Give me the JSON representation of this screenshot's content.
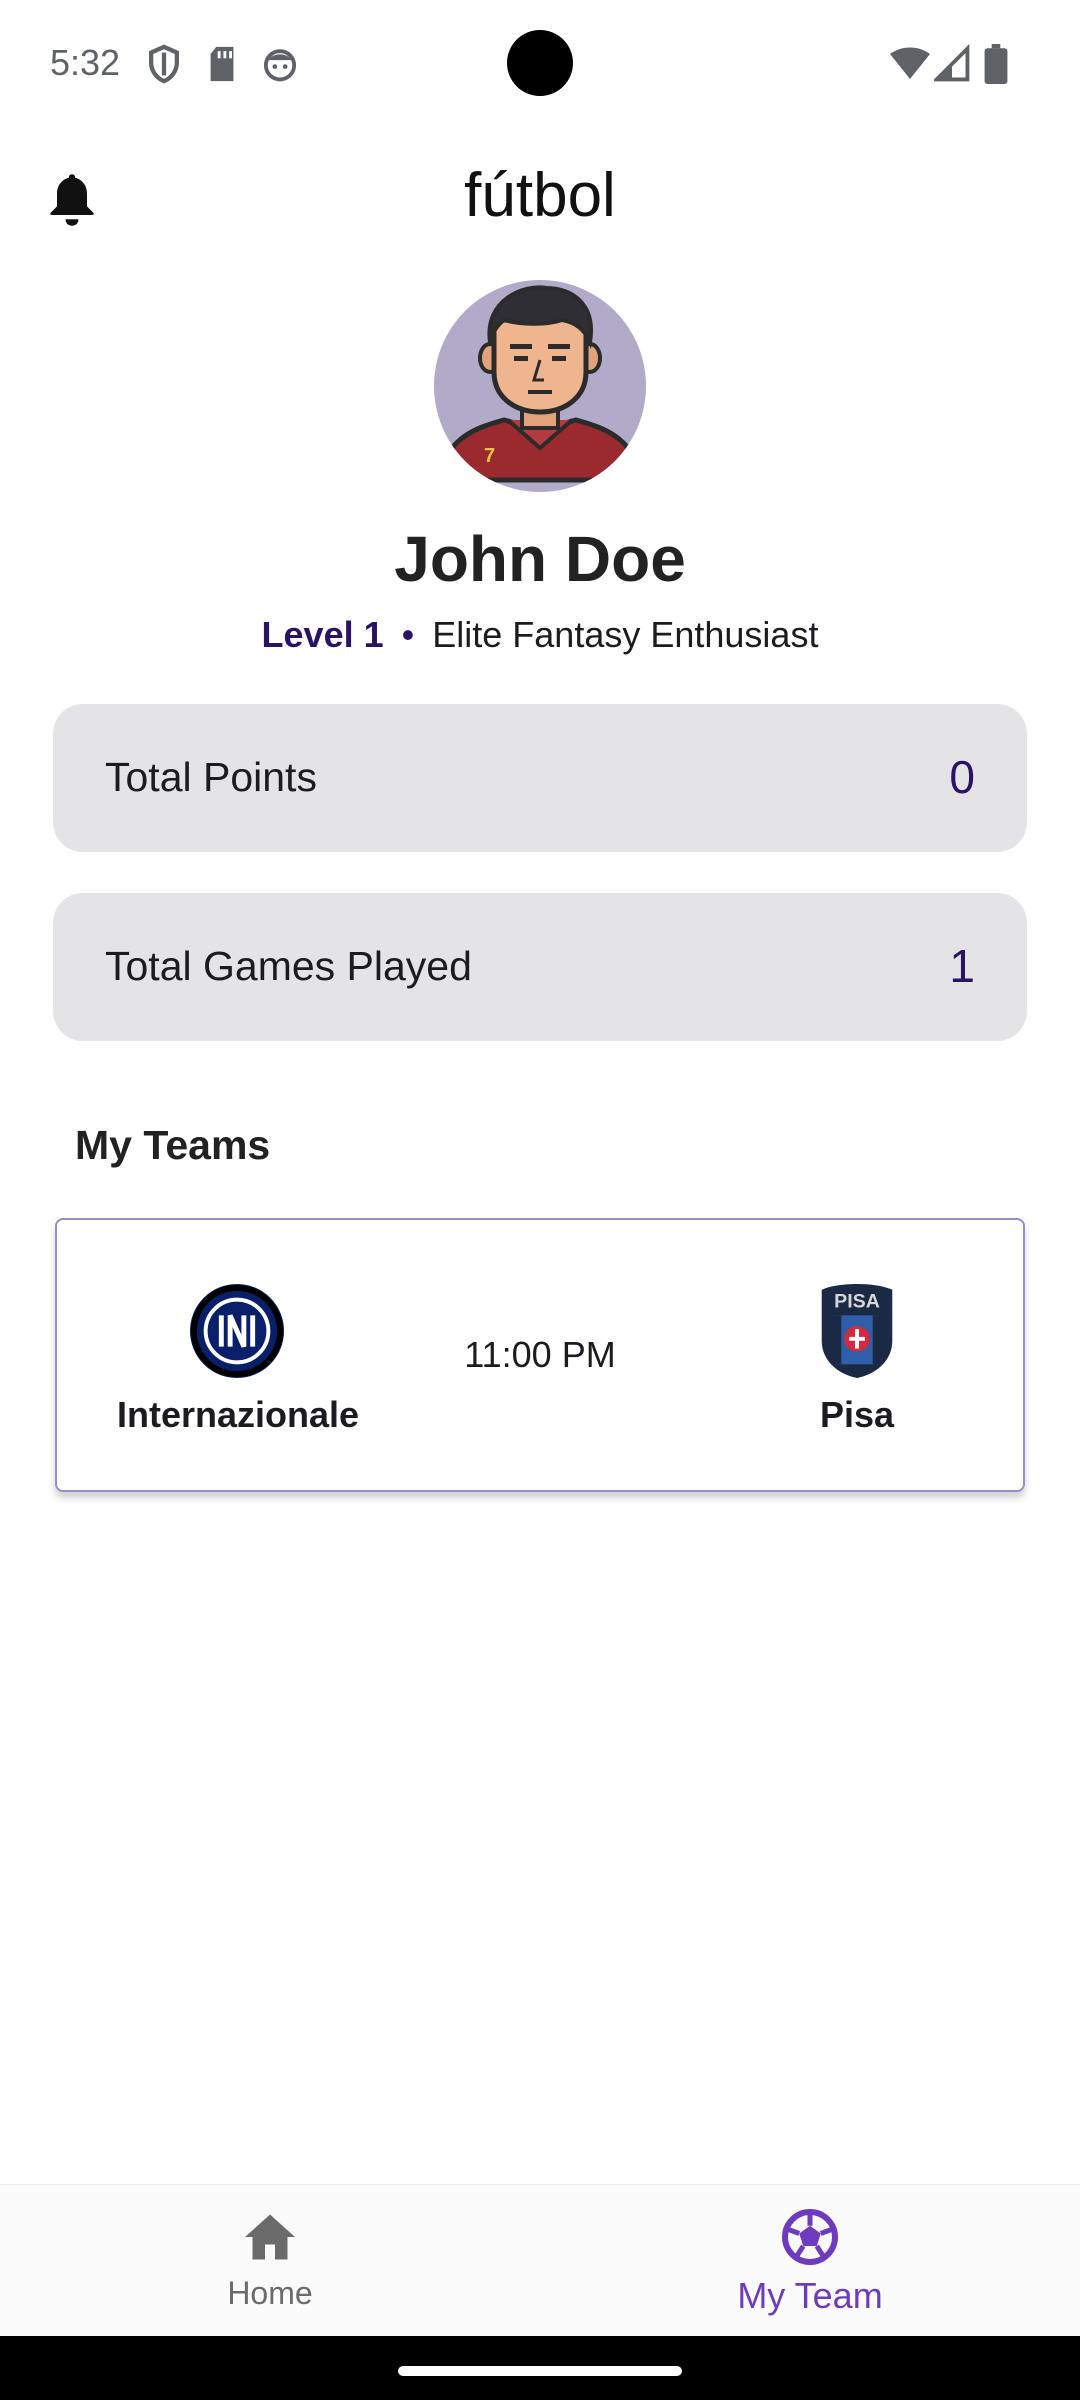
{
  "status_bar": {
    "time": "5:32",
    "left_icons": [
      "shield-icon",
      "sd-card-icon",
      "face-icon"
    ],
    "right_icons": [
      "wifi-icon",
      "cell-signal-icon",
      "battery-icon"
    ]
  },
  "header": {
    "title": "fútbol",
    "bell_icon": "bell-icon"
  },
  "profile": {
    "name": "John Doe",
    "level": "Level 1",
    "separator": "•",
    "tagline": "Elite Fantasy Enthusiast",
    "avatar_bg": "#b1aac9"
  },
  "stats": [
    {
      "label": "Total Points",
      "value": "0"
    },
    {
      "label": "Total Games Played",
      "value": "1"
    }
  ],
  "my_teams": {
    "title": "My Teams",
    "match": {
      "home_team": "Internazionale",
      "away_team": "Pisa",
      "time": "11:00 PM"
    }
  },
  "bottom_nav": {
    "items": [
      {
        "label": "Home",
        "icon": "home-icon",
        "active": false
      },
      {
        "label": "My Team",
        "icon": "soccer-ball-icon",
        "active": true
      }
    ]
  },
  "colors": {
    "accent": "#6e3bbf",
    "stat_value": "#2a1266",
    "card_bg": "#e4e4e6"
  }
}
